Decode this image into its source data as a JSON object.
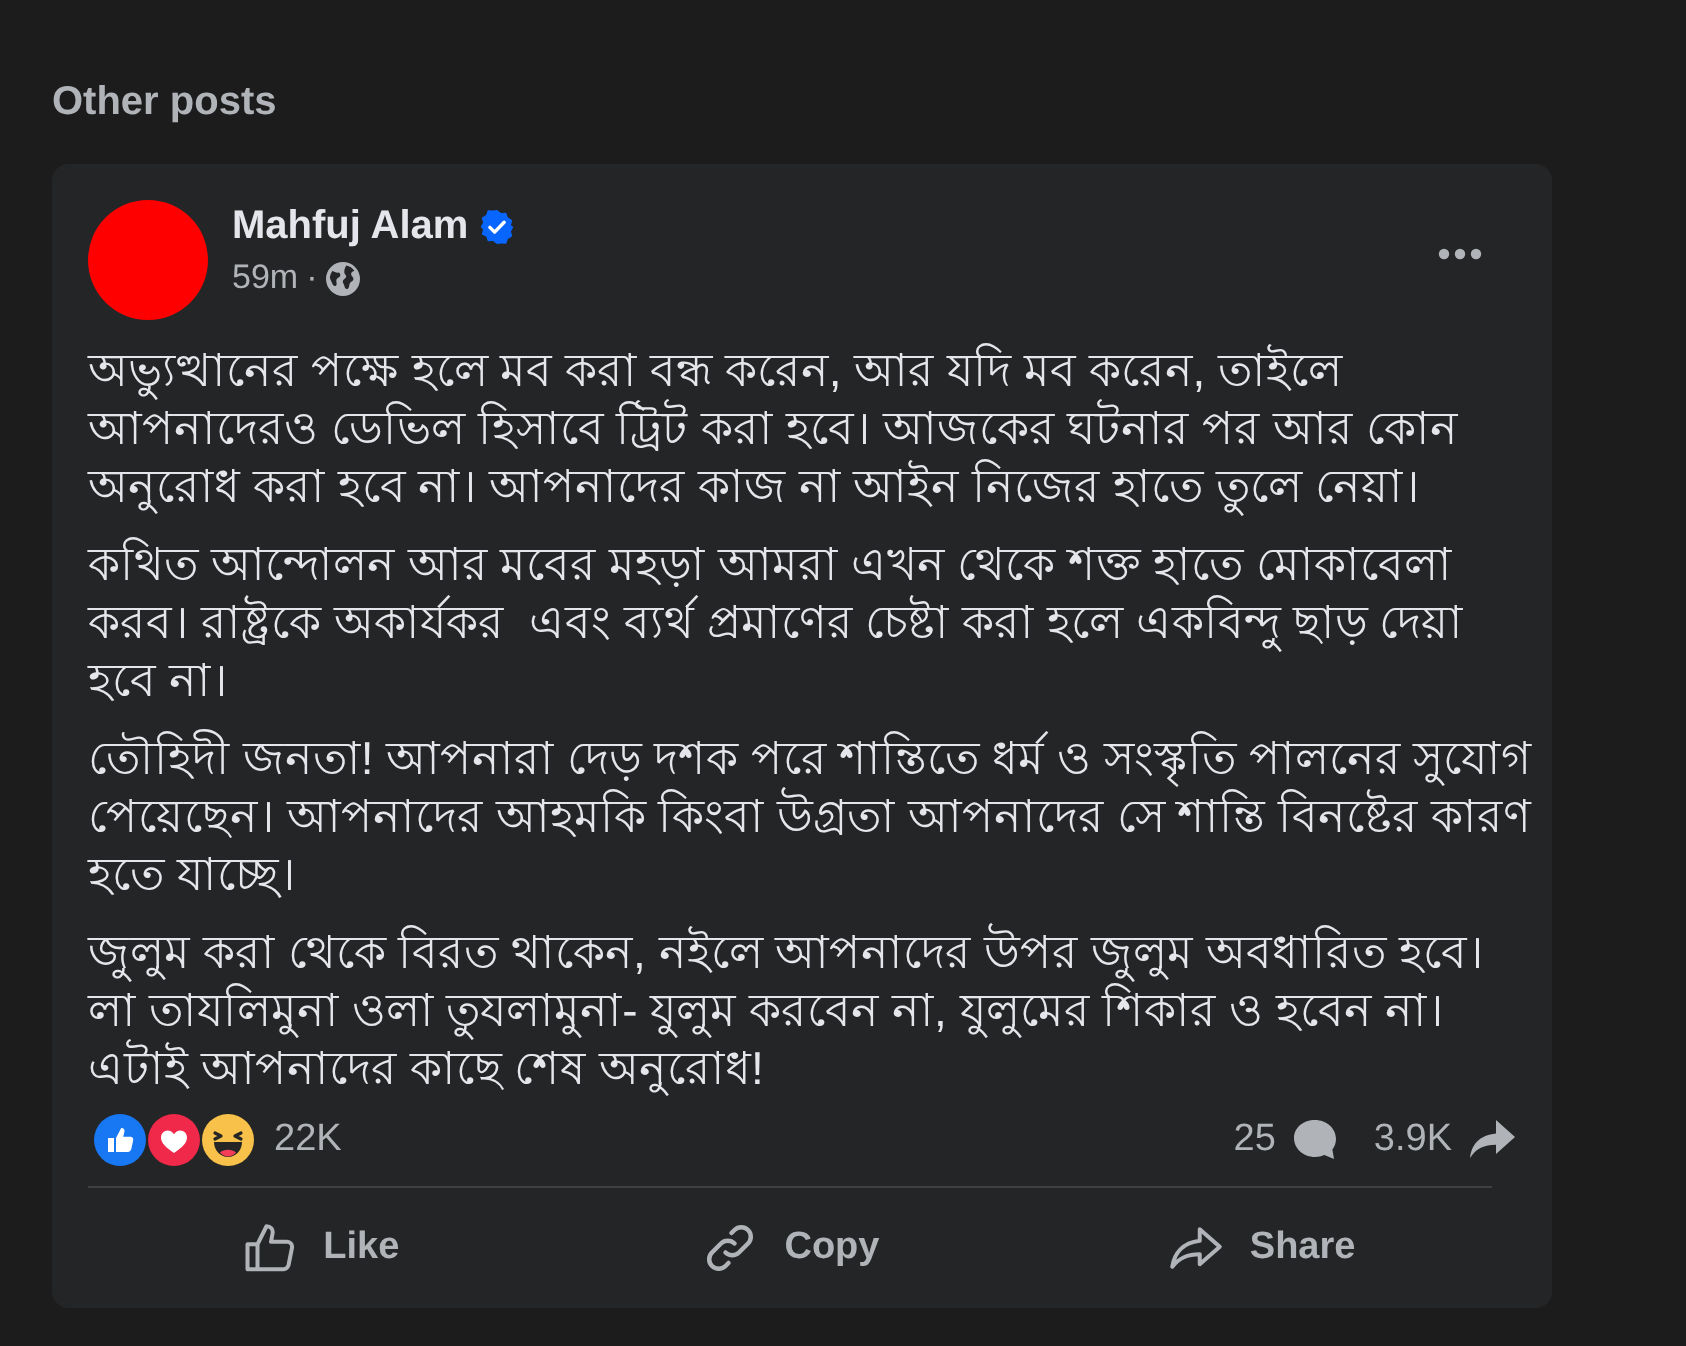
{
  "section_title": "Other posts",
  "post": {
    "author": {
      "name": "Mahfuj Alam",
      "verified": true
    },
    "time": "59m",
    "separator": "·",
    "paragraphs": [
      "অভ্যুত্থানের পক্ষে হলে মব করা বন্ধ করেন, আর যদি মব করেন, তাইলে আপনাদেরও ডেভিল হিসাবে ট্রিট করা হবে। আজকের ঘটনার পর আর কোন অনুরোধ করা হবে না। আপনাদের কাজ না আইন নিজের হাতে তুলে নেয়া।",
      "কথিত আন্দোলন আর মবের মহড়া আমরা এখন থেকে শক্ত হাতে মোকাবেলা করব। রাষ্ট্রকে অকার্যকর  এবং ব্যর্থ প্রমাণের চেষ্টা করা হলে একবিন্দু ছাড় দেয়া হবে না।",
      "তৌহিদী জনতা! আপনারা দেড় দশক পরে শান্তিতে ধর্ম ও সংস্কৃতি পালনের সুযোগ পেয়েছেন। আপনাদের আহমকি কিংবা উগ্রতা আপনাদের সে শান্তি বিনষ্টের কারণ হতে যাচ্ছে।",
      "জুলুম করা থেকে বিরত থাকেন, নইলে আপনাদের উপর জুলুম অবধারিত হবে।  লা তাযলিমুনা ওলা তুযলামুনা- যুলুম করবেন না, যুলুমের শিকার ও হবেন না। এটাই আপনাদের কাছে শেষ অনুরোধ!"
    ],
    "stats": {
      "reactions": "22K",
      "comments": "25",
      "shares": "3.9K"
    },
    "actions": [
      {
        "kind": "like",
        "label": "Like"
      },
      {
        "kind": "copy",
        "label": "Copy"
      },
      {
        "kind": "share",
        "label": "Share"
      }
    ]
  }
}
